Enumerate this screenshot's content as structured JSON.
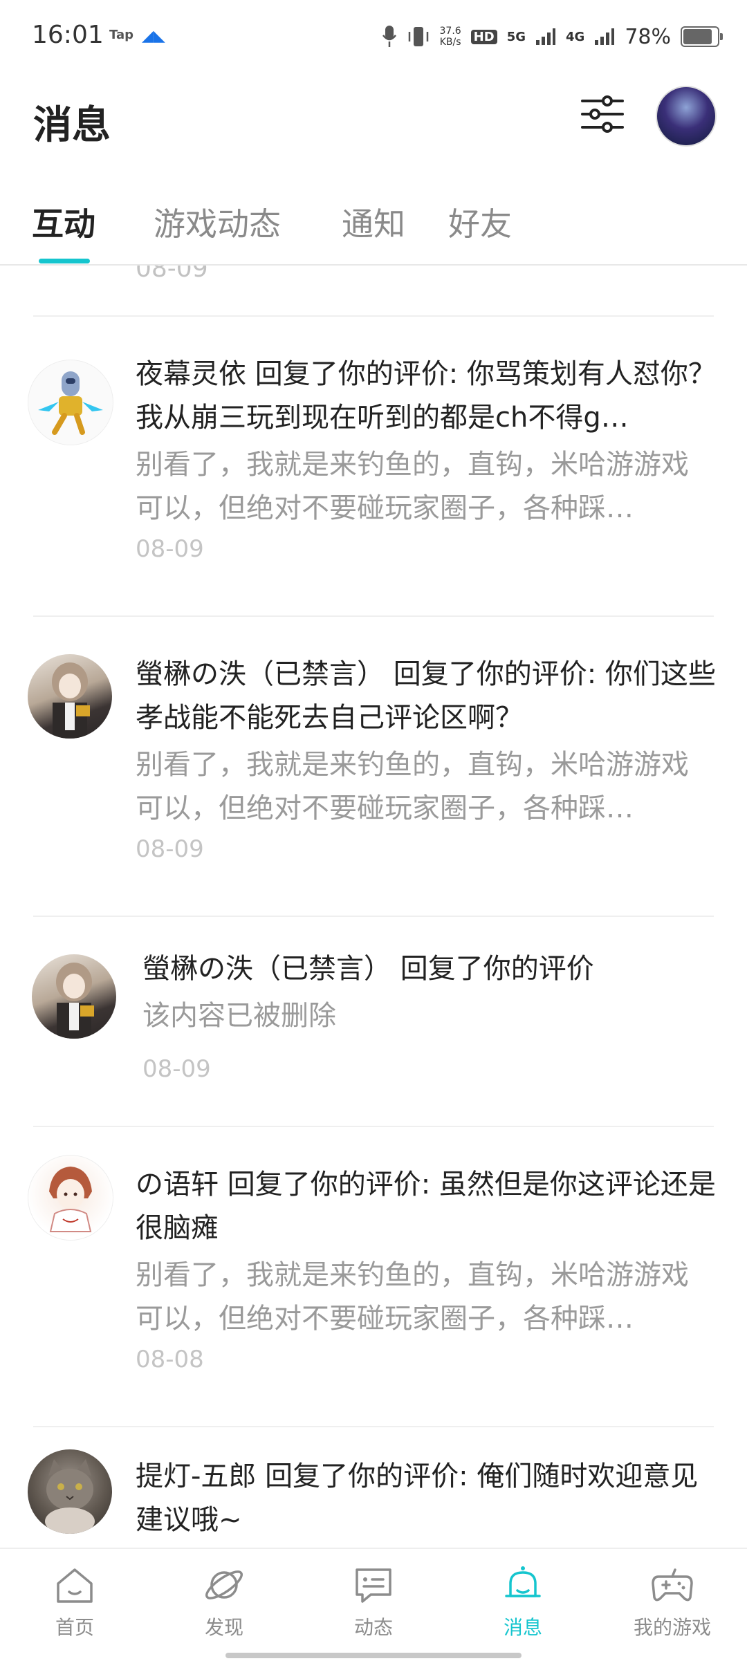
{
  "status_bar": {
    "time": "16:01",
    "tap_label": "Tap",
    "net_speed_value": "37.6",
    "net_speed_unit": "KB/s",
    "hd_label": "HD",
    "signal_1": "5G",
    "signal_2": "4G",
    "battery_percent": "78%",
    "battery_level": 0.78
  },
  "header": {
    "title": "消息"
  },
  "tabs": [
    {
      "label": "互动",
      "active": true
    },
    {
      "label": "游戏动态",
      "active": false
    },
    {
      "label": "通知",
      "active": false
    },
    {
      "label": "好友",
      "active": false
    }
  ],
  "list": {
    "prev_date": "08-09",
    "items": [
      {
        "headline": "夜幕灵依 回复了你的评价: 你骂策划有人怼你？我从崩三玩到现在听到的都是ch不得g…",
        "quote": "别看了，我就是来钓鱼的，直钩，米哈游游戏可以，但绝对不要碰玩家圈子，各种踩…",
        "date": "08-09"
      },
      {
        "headline": "螢楙の泆（已禁言） 回复了你的评价: 你们这些孝战能不能死去自己评论区啊？",
        "quote": "别看了，我就是来钓鱼的，直钩，米哈游游戏可以，但绝对不要碰玩家圈子，各种踩…",
        "date": "08-09"
      },
      {
        "headline": "螢楙の泆（已禁言） 回复了你的评价",
        "quote": "该内容已被删除",
        "date": "08-09"
      },
      {
        "headline": "の语轩 回复了你的评价: 虽然但是你这评论还是很脑瘫",
        "quote": "别看了，我就是来钓鱼的，直钩，米哈游游戏可以，但绝对不要碰玩家圈子，各种踩…",
        "date": "08-08"
      },
      {
        "headline": "提灯-五郎 回复了你的评价: 俺们随时欢迎意见建议哦~",
        "quote": "",
        "date": ""
      }
    ]
  },
  "bottom_nav": [
    {
      "label": "首页",
      "icon": "home-icon"
    },
    {
      "label": "发现",
      "icon": "planet-icon"
    },
    {
      "label": "动态",
      "icon": "chat-icon"
    },
    {
      "label": "消息",
      "icon": "bell-icon",
      "active": true
    },
    {
      "label": "我的游戏",
      "icon": "gamepad-icon"
    }
  ],
  "colors": {
    "accent": "#15c5ce",
    "text_primary": "#222222",
    "text_secondary": "#9a9a9a",
    "text_date": "#c4c4c4"
  }
}
